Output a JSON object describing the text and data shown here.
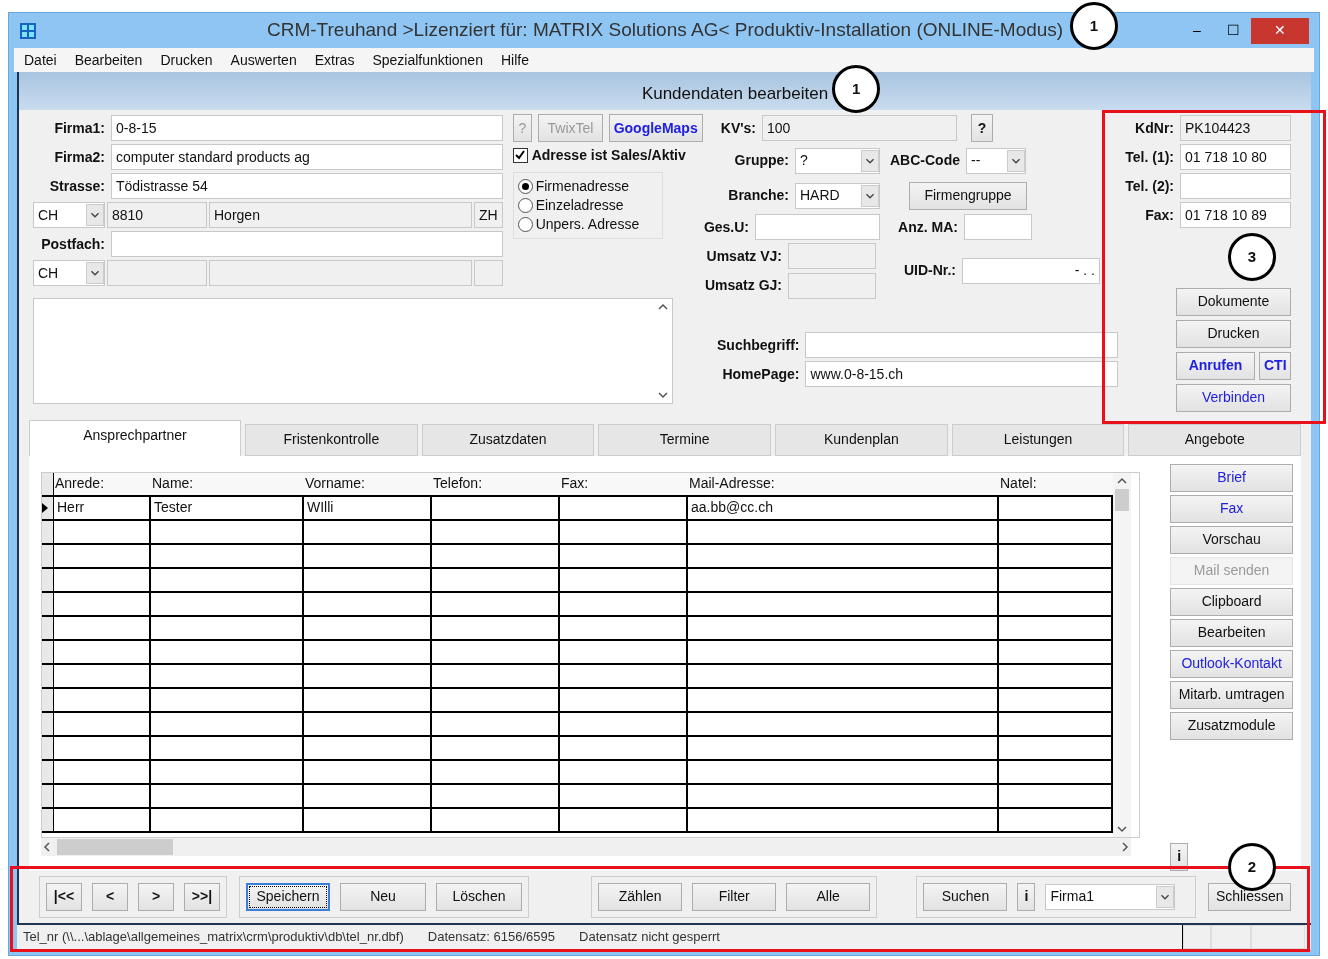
{
  "window": {
    "title": "CRM-Treuhand >Lizenziert für: MATRIX Solutions AG< Produktiv-Installation (ONLINE-Modus)",
    "controls": [
      "–",
      "☐",
      "✕"
    ]
  },
  "menu": [
    "Datei",
    "Bearbeiten",
    "Drucken",
    "Auswerten",
    "Extras",
    "Spezialfunktionen",
    "Hilfe"
  ],
  "header": "Kundendaten bearbeiten",
  "address": {
    "firma1_label": "Firma1:",
    "firma1": "0-8-15",
    "firma2_label": "Firma2:",
    "firma2": "computer standard products ag",
    "strasse_label": "Strasse:",
    "strasse": "Tödistrasse 54",
    "country": "CH",
    "plz": "8810",
    "ort": "Horgen",
    "kanton": "ZH",
    "postfach_label": "Postfach:",
    "postfach_country": "CH"
  },
  "lookup": {
    "help": "?",
    "twixtel": "TwixTel",
    "googlemaps": "GoogleMaps"
  },
  "sales_active": {
    "label": "Adresse ist Sales/Aktiv",
    "checked": true
  },
  "address_types": [
    {
      "label": "Firmenadresse",
      "selected": true
    },
    {
      "label": "Einzeladresse",
      "selected": false
    },
    {
      "label": "Unpers. Adresse",
      "selected": false
    }
  ],
  "details": {
    "kvs_label": "KV's:",
    "kvs": "100",
    "help": "?",
    "gruppe_label": "Gruppe:",
    "gruppe": "?",
    "abc_label": "ABC-Code",
    "abc": "--",
    "branche_label": "Branche:",
    "branche": "HARD",
    "firmengruppe": "Firmengruppe",
    "gesu_label": "Ges.U:",
    "anzma_label": "Anz. MA:",
    "umsatz_vj_label": "Umsatz VJ:",
    "umsatz_gj_label": "Umsatz GJ:",
    "uid_label": "UID-Nr.:",
    "uid": "-  .  .",
    "such_label": "Suchbegriff:",
    "homepage_label": "HomePage:",
    "homepage": "www.0-8-15.ch"
  },
  "contact": {
    "kdnr_label": "KdNr:",
    "kdnr": "PK104423",
    "tel1_label": "Tel. (1):",
    "tel1": "01 718 10 80",
    "tel2_label": "Tel. (2):",
    "fax_label": "Fax:",
    "fax": "01 718 10 89",
    "dokumente": "Dokumente",
    "drucken": "Drucken",
    "anrufen": "Anrufen",
    "cti": "CTI",
    "verbinden": "Verbinden"
  },
  "tabs": [
    {
      "label": "Ansprechpartner",
      "selected": true
    },
    {
      "label": "Fristenkontrolle",
      "selected": false
    },
    {
      "label": "Zusatzdaten",
      "selected": false
    },
    {
      "label": "Termine",
      "selected": false
    },
    {
      "label": "Kundenplan",
      "selected": false
    },
    {
      "label": "Leistungen",
      "selected": false
    },
    {
      "label": "Angebote",
      "selected": false
    }
  ],
  "table": {
    "columns": [
      "Anrede:",
      "Name:",
      "Vorname:",
      "Telefon:",
      "Fax:",
      "Mail-Adresse:",
      "Natel:"
    ],
    "rows": [
      {
        "current": true,
        "cells": [
          "Herr",
          "Tester",
          "WIlli",
          null,
          null,
          "aa.bb@cc.ch",
          null
        ]
      }
    ]
  },
  "side_buttons": [
    {
      "label": "Brief",
      "kind": "link",
      "disabled": false
    },
    {
      "label": "Fax",
      "kind": "link",
      "disabled": false
    },
    {
      "label": "Vorschau",
      "kind": "plain",
      "disabled": false
    },
    {
      "label": "Mail senden",
      "kind": "plain",
      "disabled": true
    },
    {
      "label": "Clipboard",
      "kind": "plain",
      "disabled": false
    },
    {
      "label": "Bearbeiten",
      "kind": "plain",
      "disabled": false
    },
    {
      "label": "Outlook-Kontakt",
      "kind": "link",
      "disabled": false
    },
    {
      "label": "Mitarb. umtragen",
      "kind": "plain",
      "disabled": false
    },
    {
      "label": "Zusatzmodule",
      "kind": "plain",
      "disabled": false
    }
  ],
  "info_button": "i",
  "toolbar": {
    "nav": [
      "|<<",
      "<",
      ">",
      ">>|"
    ],
    "record": [
      {
        "label": "Speichern",
        "focused": true
      },
      {
        "label": "Neu",
        "focused": false
      },
      {
        "label": "Löschen",
        "focused": false
      }
    ],
    "filter": [
      "Zählen",
      "Filter",
      "Alle"
    ],
    "search": "Suchen",
    "search_info": "i",
    "search_field": "Firma1",
    "close": "Schliessen"
  },
  "status_bar": [
    "Tel_nr (\\\\...\\ablage\\allgemeines_matrix\\crm\\produktiv\\db\\tel_nr.dbf)",
    "Datensatz: 6156/6595",
    "Datensatz nicht gesperrt"
  ],
  "callouts": {
    "title": "1",
    "header": "1",
    "contact_panel": "3",
    "toolbar": "2"
  }
}
